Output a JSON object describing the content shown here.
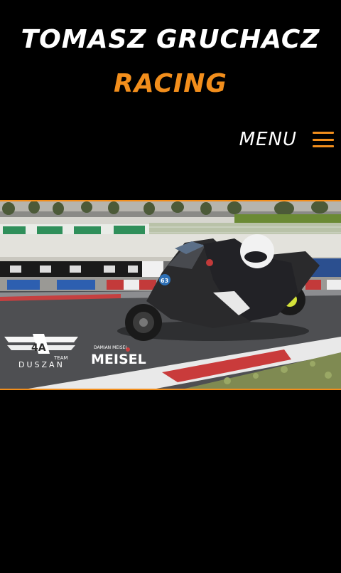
{
  "header": {
    "title_line1": "TOMASZ GRUCHACZ",
    "title_line2": "RACING"
  },
  "nav": {
    "menu_label": "MENU",
    "menu_icon": "hamburger-menu-icon"
  },
  "hero": {
    "logo_left_top": "4A",
    "logo_left_small": "TEAM",
    "logo_left_bottom": "DUSZAN",
    "logo_right_small": "DAMIAN MEISEL",
    "logo_right_main": "MEISEL",
    "bike_number": "63"
  },
  "colors": {
    "background": "#000000",
    "accent": "#f28e1c",
    "title": "#ffffff"
  }
}
